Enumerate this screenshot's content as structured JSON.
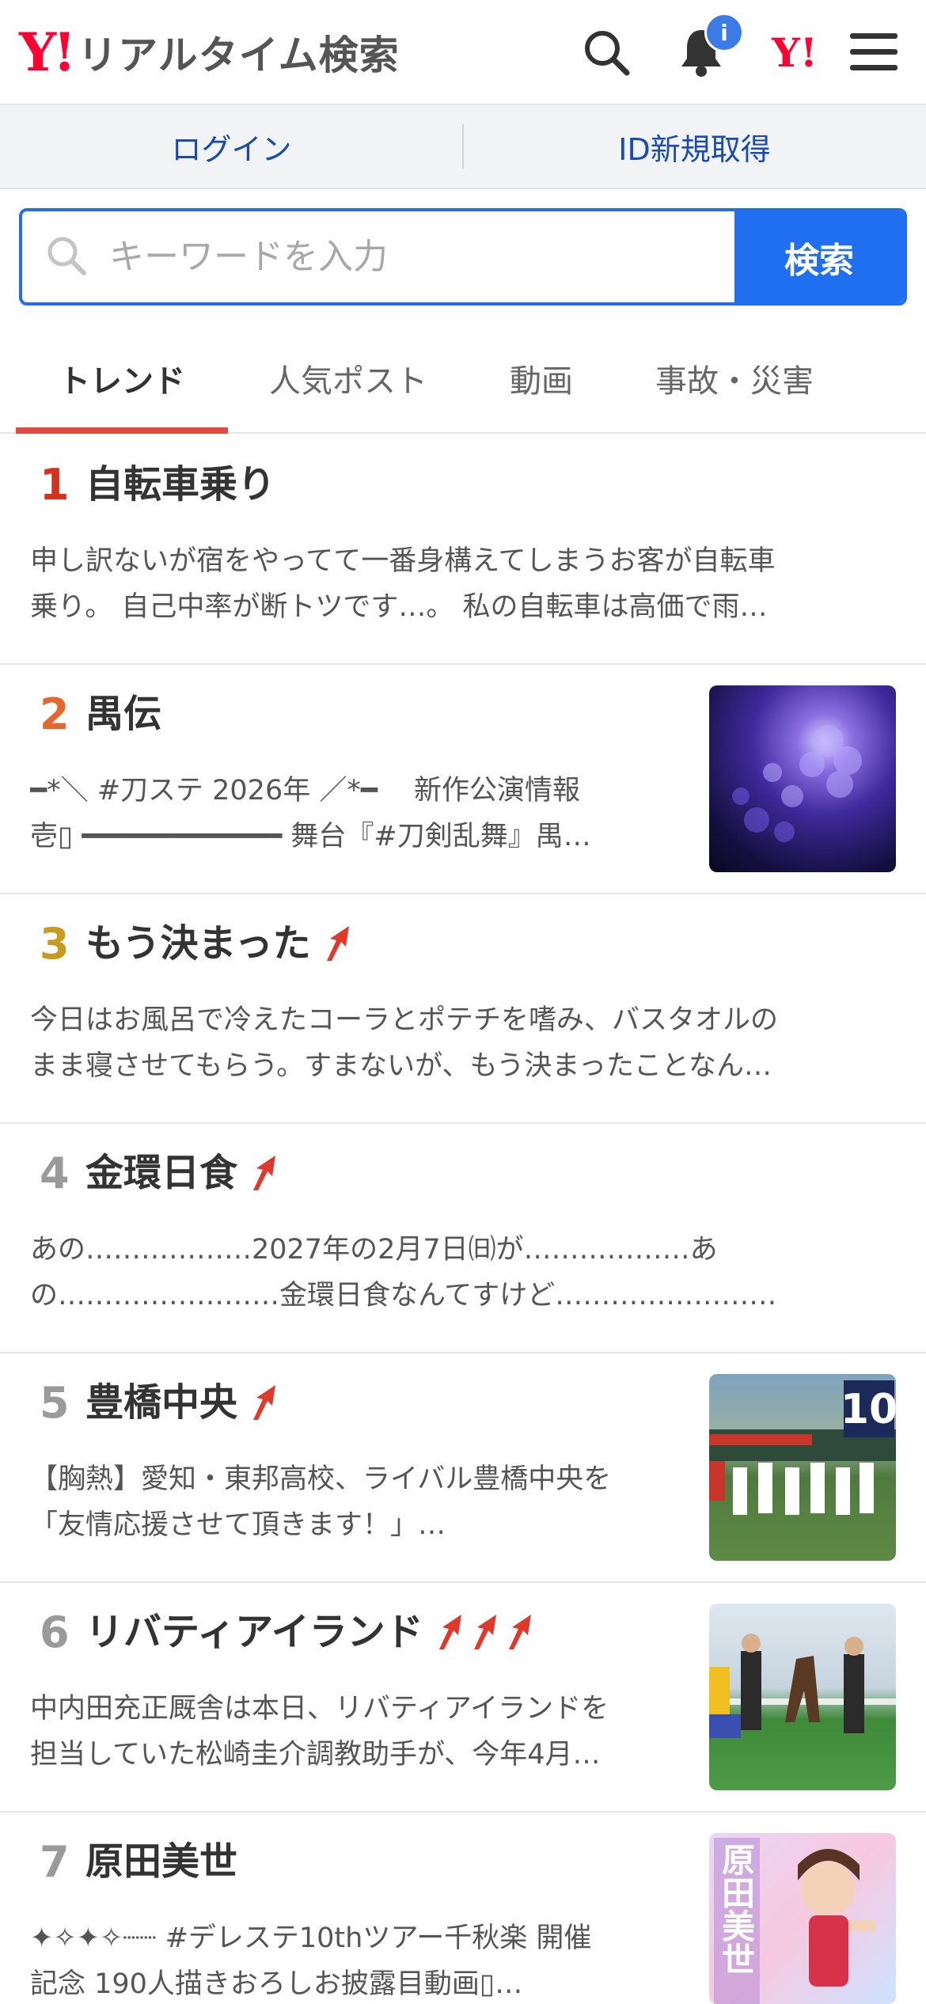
{
  "header": {
    "logo_mark": "Y!",
    "logo_text": "リアルタイム検索",
    "notification_badge": "i",
    "yj_mark": "Y!"
  },
  "account": {
    "login_label": "ログイン",
    "signup_label": "ID新規取得"
  },
  "search": {
    "placeholder": "キーワードを入力",
    "button_label": "検索"
  },
  "tabs": [
    {
      "label": "トレンド",
      "active": true
    },
    {
      "label": "人気ポスト",
      "active": false
    },
    {
      "label": "動画",
      "active": false
    },
    {
      "label": "事故・災害",
      "active": false
    }
  ],
  "trends": [
    {
      "rank": "1",
      "title": "自転車乗り",
      "arrows": 0,
      "line1": "申し訳ないが宿をやってて一番身構えてしまうお客が自転車",
      "line2": "乗り。 自己中率が断トツです…。 私の自転車は高価で雨…",
      "thumb": null
    },
    {
      "rank": "2",
      "title": "禺伝",
      "arrows": 0,
      "line1": "━*＼ #刀ステ 2026年 ／*━　 新作公演情報",
      "line2": "壱▯ ━━━━━━━━━━━━ 舞台『#刀剣乱舞』禺…",
      "thumb": "purple-flowers"
    },
    {
      "rank": "3",
      "title": "もう決まった",
      "arrows": 1,
      "line1": "今日はお風呂で冷えたコーラとポテチを嗜み、バスタオルの",
      "line2": "まま寝させてもらう。すまないが、もう決まったことなん…",
      "thumb": null
    },
    {
      "rank": "4",
      "title": "金環日食",
      "arrows": 1,
      "line1": "あの………………2027年の2月7日㈰が………………あ",
      "line2": "の……………………金環日食なんてすけど……………………",
      "thumb": null
    },
    {
      "rank": "5",
      "title": "豊橋中央",
      "arrows": 1,
      "line1": "【胸熱】愛知・東邦高校、ライバル豊橋中央を",
      "line2": "「友情応援させて頂きます！」…",
      "thumb": "baseball-parade",
      "thumb_label": "10"
    },
    {
      "rank": "6",
      "title": "リバティアイランド",
      "arrows": 3,
      "line1": "中内田充正厩舎は本日、リバティアイランドを",
      "line2": "担当していた松崎圭介調教助手が、今年4月…",
      "thumb": "horse-ceremony"
    },
    {
      "rank": "7",
      "title": "原田美世",
      "arrows": 0,
      "line1": "✦✧✦✧┈┈ #デレステ10thツアー千秋楽 開催",
      "line2": "記念 190人描きおろしお披露目動画▯…",
      "thumb": "anime-card",
      "thumb_label": "原田美世"
    }
  ],
  "colors": {
    "accent_blue": "#1f6ff0",
    "brand_red": "#ff0033",
    "tab_underline": "#e04a3f",
    "rank1": "#d6301f",
    "rank2": "#e4682c",
    "rank3": "#c99a1d",
    "rank_other": "#9a9a9a"
  }
}
